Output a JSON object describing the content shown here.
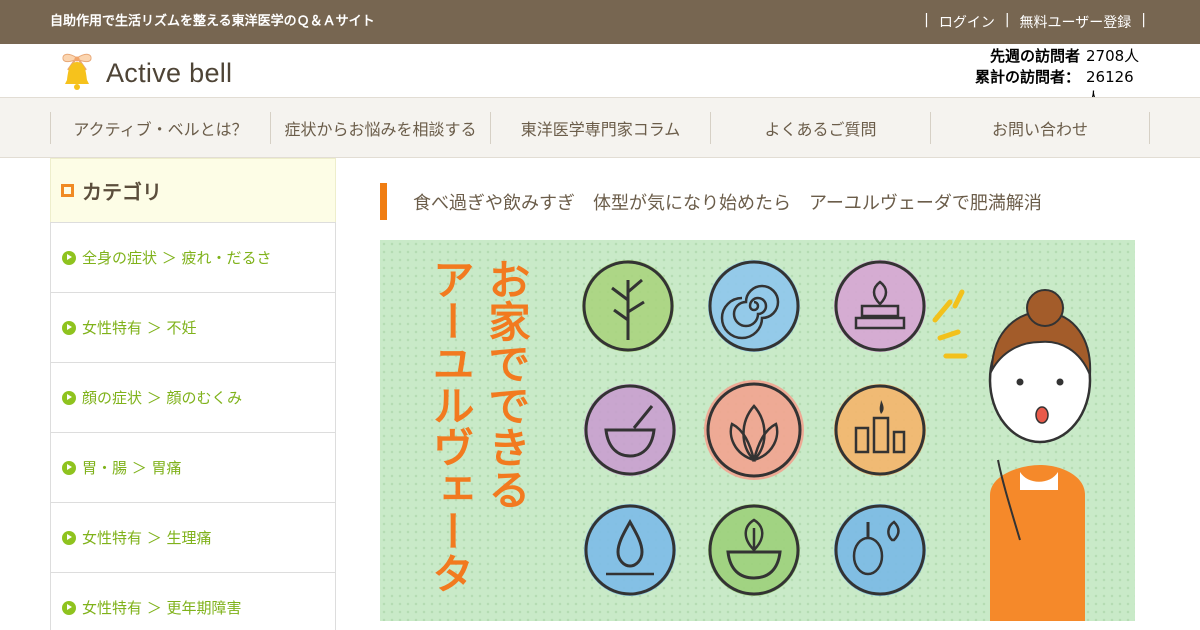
{
  "topbar": {
    "tagline": "自助作用で生活リズムを整える東洋医学のＱ＆Ａサイト",
    "login": "ログイン",
    "register": "無料ユーザー登録",
    "separator": "|"
  },
  "header": {
    "logo_text": "Active bell",
    "last_week_label": "先週の訪問者",
    "last_week_value": "2708人",
    "total_label": "累計の訪問者：",
    "total_value": "26126人"
  },
  "nav": {
    "items": [
      "アクティブ・ベルとは？",
      "症状からお悩みを相談する",
      "東洋医学専門家コラム",
      "よくあるご質問",
      "お問い合わせ"
    ]
  },
  "sidebar": {
    "title": "カテゴリ",
    "items": [
      "全身の症状 ＞ 疲れ・だるさ",
      "女性特有 ＞ 不妊",
      "顔の症状 ＞ 顔のむくみ",
      "胃・腸 ＞ 胃痛",
      "女性特有 ＞ 生理痛",
      "女性特有 ＞ 更年期障害"
    ]
  },
  "main": {
    "post_title": "食べ過ぎや飲みすぎ　体型が気になり始めたら　アーユルヴェーダで肥満解消",
    "hero_text_col1": "お家でできる",
    "hero_text_col2": "アーユルヴェータ"
  },
  "colors": {
    "topbar": "#776651",
    "accent_orange": "#f07d12",
    "category_green": "#8fc31f",
    "hero_bg": "#c9eac8"
  }
}
